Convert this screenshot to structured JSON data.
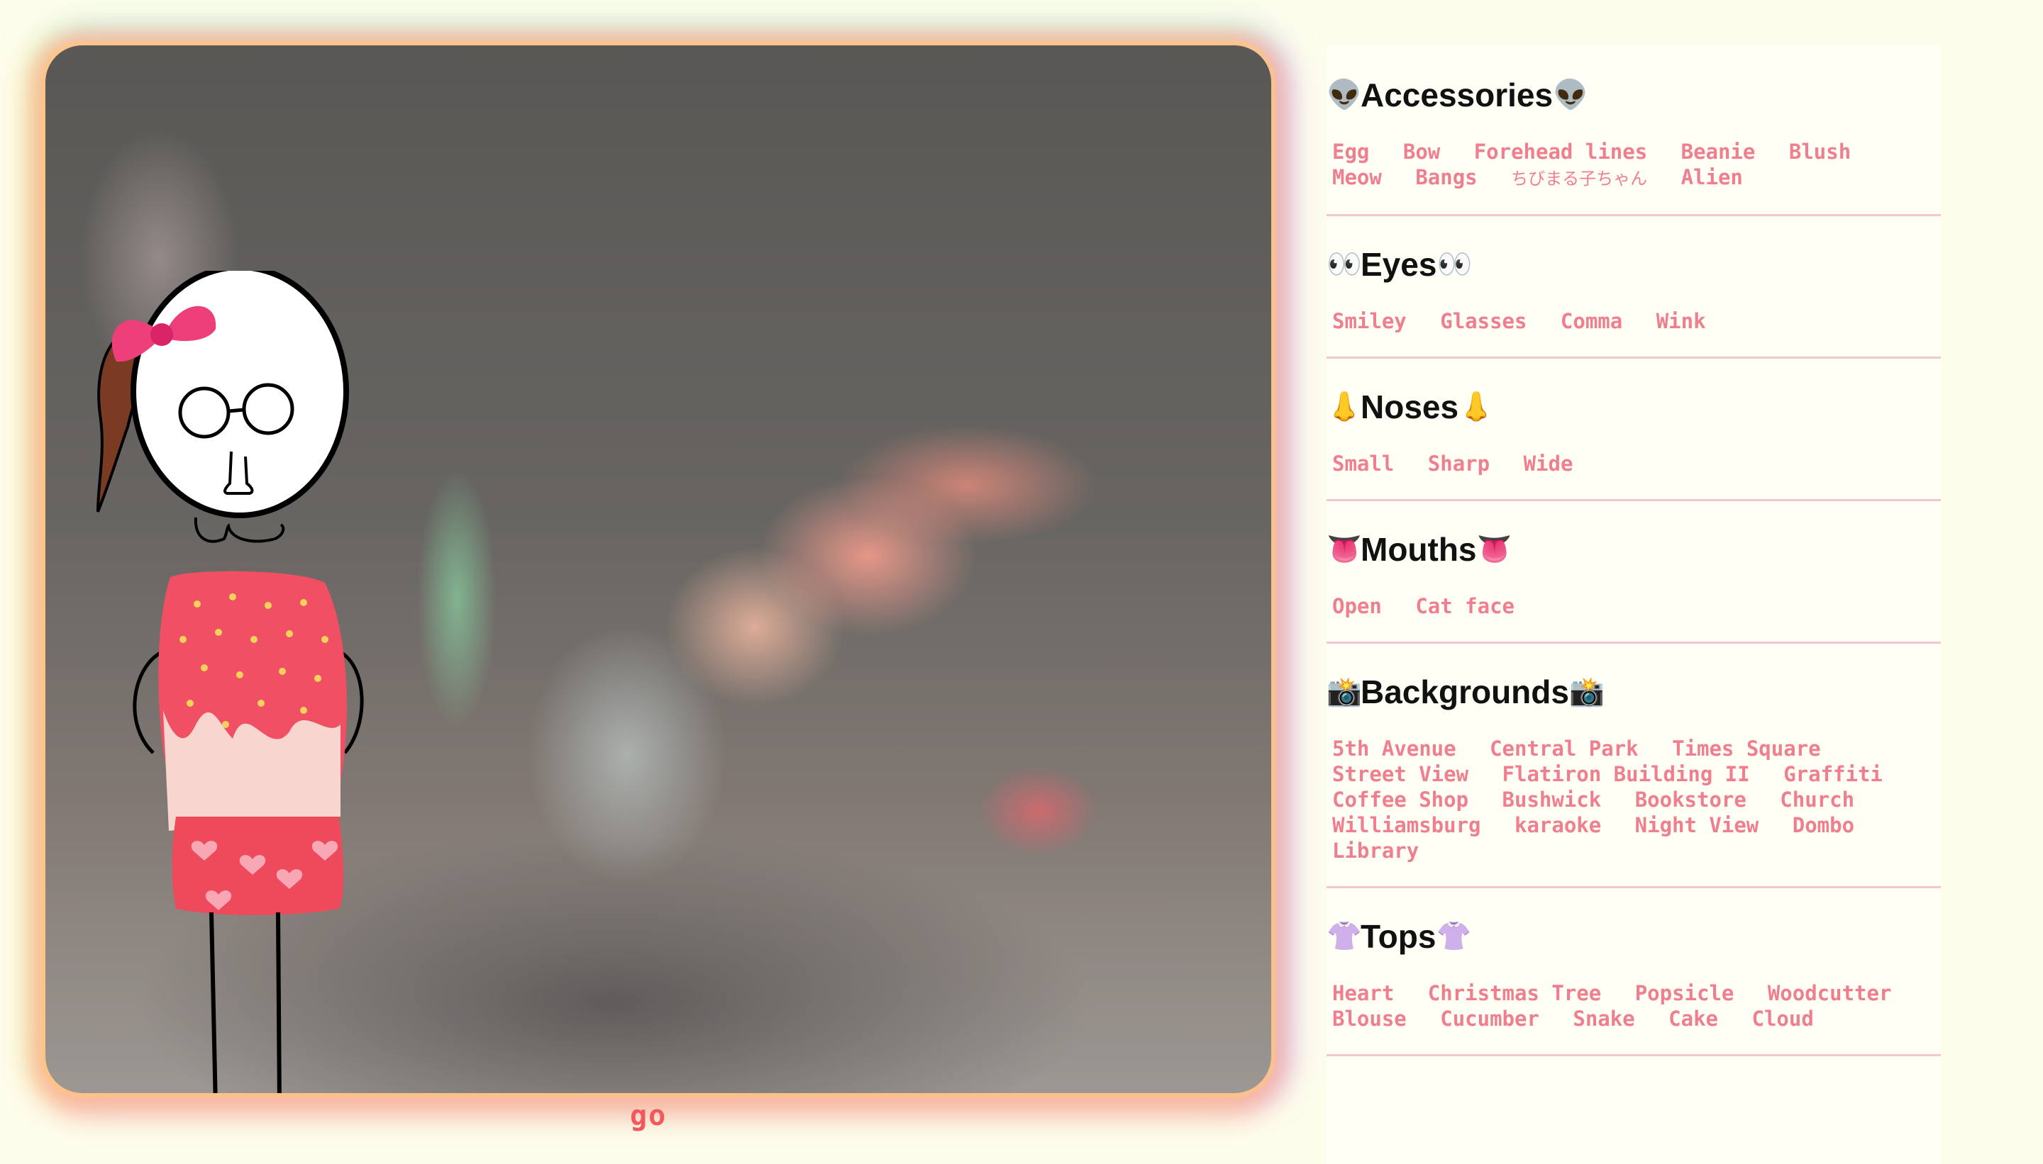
{
  "go_label": "go",
  "colors": {
    "page_bg": "#fdfdec",
    "link": "#ef7f8f",
    "divider": "#f2c7d0",
    "go": "#f2585c"
  },
  "panel": {
    "sections": [
      {
        "title": "Accessories",
        "icon": "👽",
        "icon_name": "alien-icon",
        "options": [
          "Egg",
          "Bow",
          "Forehead lines",
          "Beanie",
          "Blush",
          "Meow",
          "Bangs",
          "ちびまる子ちゃん",
          "Alien"
        ]
      },
      {
        "title": "Eyes",
        "icon": "👀",
        "icon_name": "eyes-icon",
        "options": [
          "Smiley",
          "Glasses",
          "Comma",
          "Wink"
        ]
      },
      {
        "title": "Noses",
        "icon": "👃",
        "icon_name": "nose-icon",
        "options": [
          "Small",
          "Sharp",
          "Wide"
        ]
      },
      {
        "title": "Mouths",
        "icon": "👅",
        "icon_name": "tongue-icon",
        "options": [
          "Open",
          "Cat face"
        ]
      },
      {
        "title": "Backgrounds",
        "icon": "📸",
        "icon_name": "camera-flash-icon",
        "options": [
          "5th Avenue",
          "Central Park",
          "Times Square",
          "Street View",
          "Flatiron Building II",
          "Graffiti",
          "Coffee Shop",
          "Bushwick",
          "Bookstore",
          "Church",
          "Williamsburg",
          "karaoke",
          "Night View",
          "Dombo",
          "Library"
        ]
      },
      {
        "title": "Tops",
        "icon": "👚",
        "icon_name": "blouse-icon",
        "options": [
          "Heart",
          "Christmas Tree",
          "Popsicle",
          "Woodcutter",
          "Blouse",
          "Cucumber",
          "Snake",
          "Cake",
          "Cloud"
        ]
      }
    ]
  }
}
